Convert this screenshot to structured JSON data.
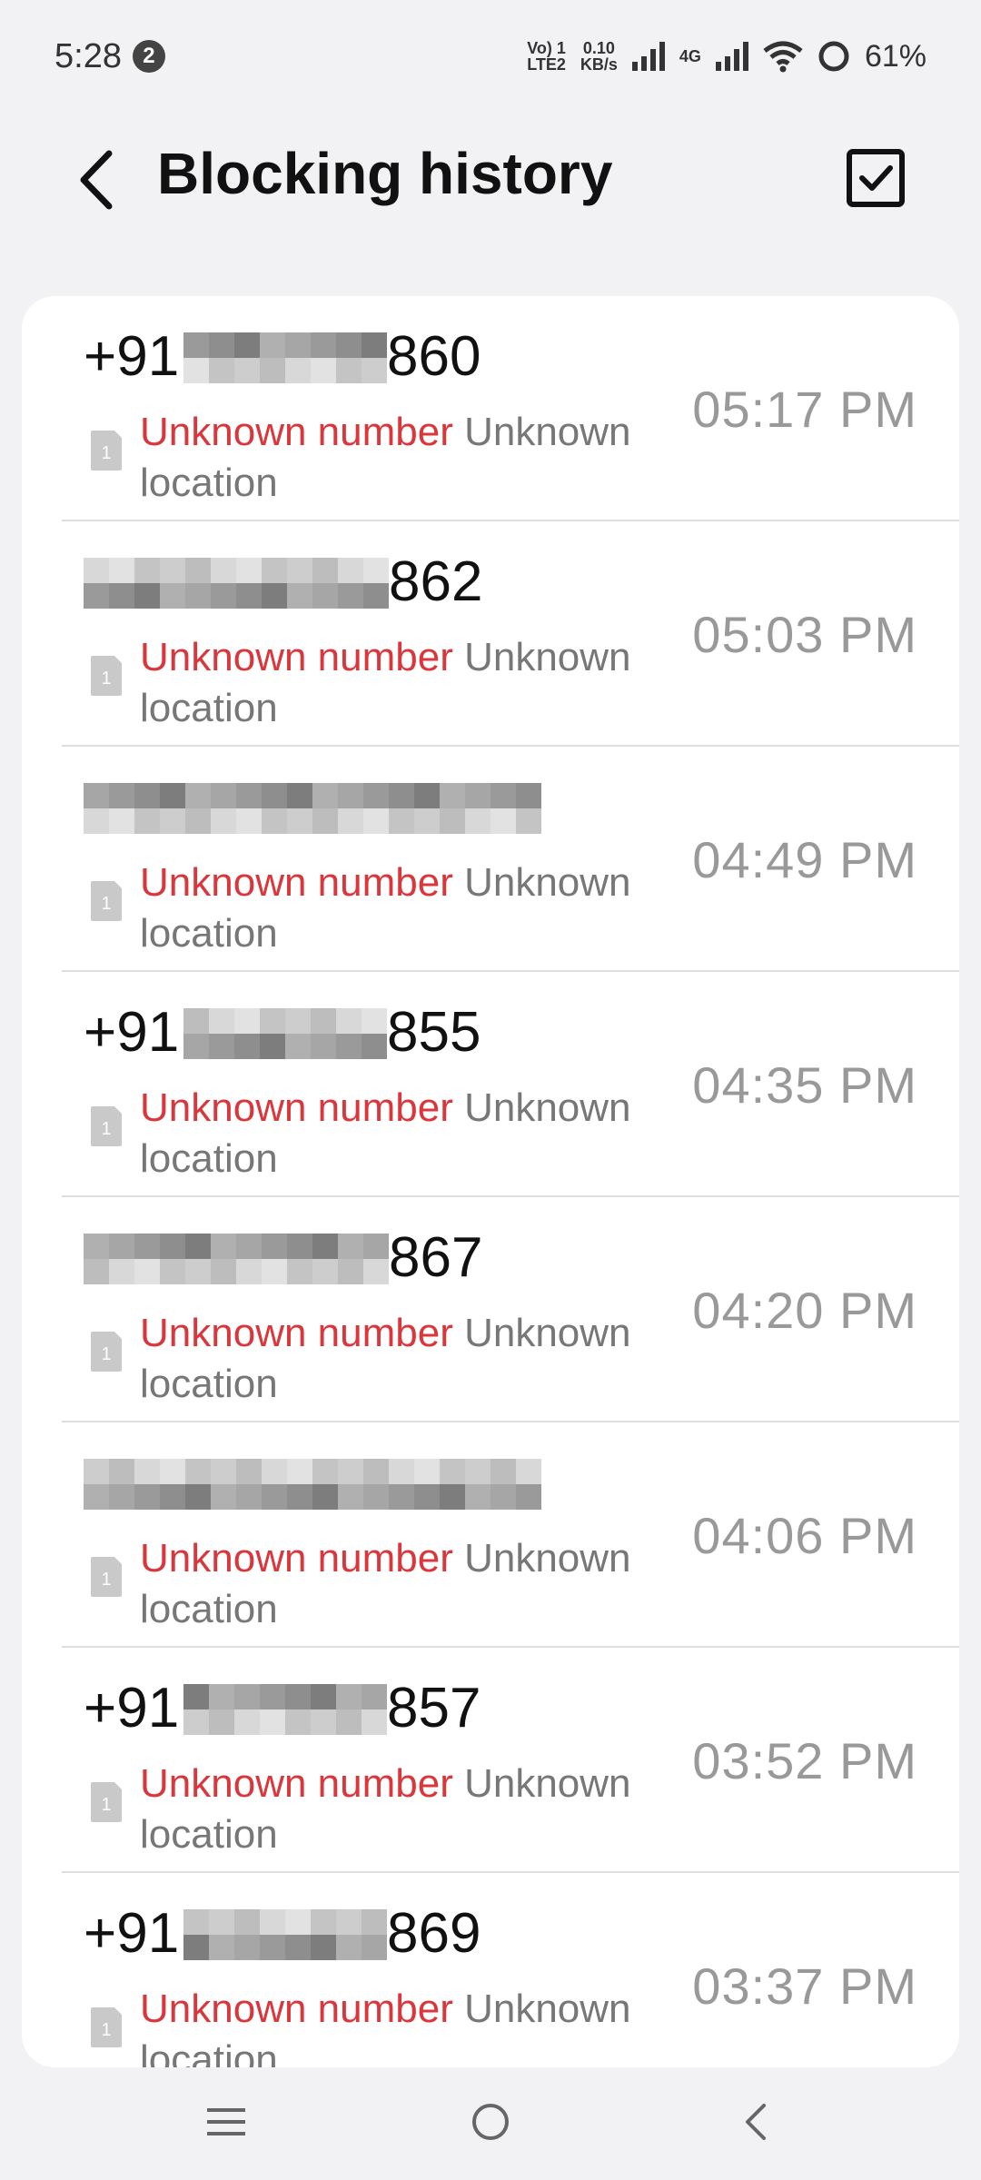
{
  "status_bar": {
    "time": "5:28",
    "notification_count": "2",
    "volte": "Vo) 1",
    "lte": "LTE2",
    "speed_value": "0.10",
    "speed_unit": "KB/s",
    "network": "4G",
    "battery": "61%"
  },
  "app_bar": {
    "title": "Blocking history",
    "back_icon": "back-arrow-icon",
    "select_icon": "checkbox-icon"
  },
  "list": {
    "items": [
      {
        "number_prefix": "+91",
        "number_suffix": "860",
        "label_red": "Unknown number",
        "label_gray": " Unknown location",
        "time": "05:17 PM"
      },
      {
        "number_prefix": "",
        "number_suffix": "862",
        "label_red": "Unknown number",
        "label_gray": " Unknown location",
        "time": "05:03 PM"
      },
      {
        "number_prefix": "",
        "number_suffix": "",
        "label_red": "Unknown number",
        "label_gray": " Unknown location",
        "time": "04:49 PM"
      },
      {
        "number_prefix": "+91",
        "number_suffix": "855",
        "label_red": "Unknown number",
        "label_gray": " Unknown location",
        "time": "04:35 PM"
      },
      {
        "number_prefix": "",
        "number_suffix": "867",
        "label_red": "Unknown number",
        "label_gray": " Unknown location",
        "time": "04:20 PM"
      },
      {
        "number_prefix": "",
        "number_suffix": "",
        "label_red": "Unknown number",
        "label_gray": " Unknown location",
        "time": "04:06 PM"
      },
      {
        "number_prefix": "+91",
        "number_suffix": "857",
        "label_red": "Unknown number",
        "label_gray": " Unknown location",
        "time": "03:52 PM"
      },
      {
        "number_prefix": "+91",
        "number_suffix": "869",
        "label_red": "Unknown number",
        "label_gray": " Unknown location",
        "time": "03:37 PM"
      }
    ],
    "sim_label": "1"
  },
  "nav_bar": {
    "menu_icon": "menu-icon",
    "home_icon": "home-icon",
    "back_icon": "back-icon"
  }
}
